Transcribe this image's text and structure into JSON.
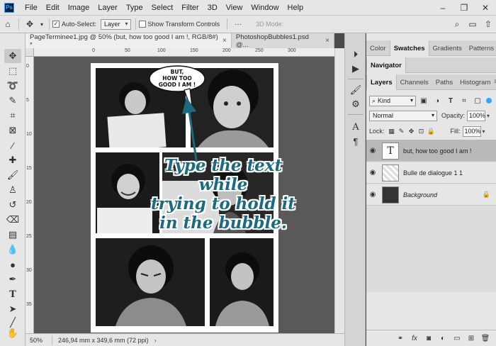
{
  "menu": {
    "items": [
      "File",
      "Edit",
      "Image",
      "Layer",
      "Type",
      "Select",
      "Filter",
      "3D",
      "View",
      "Window",
      "Help"
    ]
  },
  "options": {
    "auto_select_label": "Auto-Select:",
    "auto_select_value": "Layer",
    "transform_label": "Show Transform Controls",
    "mode_3d_label": "3D Mode:"
  },
  "doc_tabs": [
    {
      "label": "PageTerminee1.jpg @ 50% (but, how too  good I am !, RGB/8#) *",
      "close": "×"
    },
    {
      "label": "PhotoshopBubbles1.psd @...",
      "close": "×"
    }
  ],
  "ruler": {
    "h_marks": [
      "0",
      "50",
      "100",
      "150",
      "200",
      "250",
      "300"
    ],
    "v_marks": [
      "0",
      "5",
      "10",
      "15",
      "20",
      "25",
      "30",
      "35"
    ]
  },
  "canvas": {
    "bubble_text": "BUT,\nHOW TOO\nGOOD I AM !"
  },
  "annotation": {
    "text": "Type the text while\ntrying to hold it\nin the bubble."
  },
  "status": {
    "zoom": "50%",
    "info": "246,94 mm x 349,6 mm (72 ppi)",
    "arrow": "›"
  },
  "panels": {
    "top_tabs": [
      "Color",
      "Swatches",
      "Gradients",
      "Patterns"
    ],
    "nav_tab": "Navigator",
    "layer_tabs": [
      "Layers",
      "Channels",
      "Paths",
      "Histogram"
    ],
    "kind": "Kind",
    "blend_mode": "Normal",
    "opacity_label": "Opacity:",
    "opacity_value": "100%",
    "lock_label": "Lock:",
    "fill_label": "Fill:",
    "fill_value": "100%",
    "layers": [
      {
        "name": "but, how too  good I am !",
        "type": "text",
        "selected": true
      },
      {
        "name": "Bulle de dialogue 1 1",
        "type": "shape",
        "selected": false
      },
      {
        "name": "Background",
        "type": "image",
        "selected": false,
        "locked": true
      }
    ]
  },
  "colors": {
    "accent": "#31a8ff",
    "annotation": "#1b6a7d",
    "canvas_bg": "#595959",
    "panel_bg": "#e6e6e6"
  }
}
